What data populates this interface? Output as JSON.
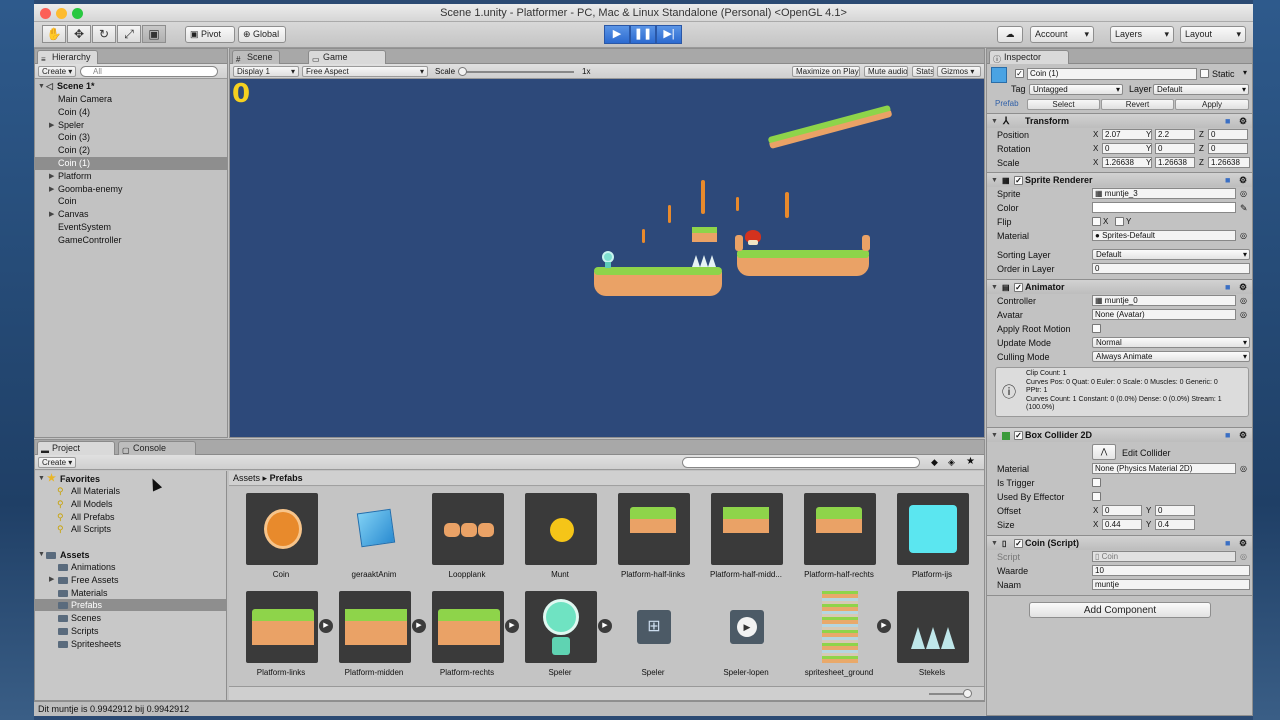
{
  "window": {
    "title": "Scene 1.unity - Platformer - PC, Mac & Linux Standalone (Personal) <OpenGL 4.1>"
  },
  "toolbar": {
    "pivot": "Pivot",
    "global": "Global",
    "account": "Account",
    "layers": "Layers",
    "layout": "Layout"
  },
  "hierarchy": {
    "tab": "Hierarchy",
    "create": "Create",
    "search_placeholder": "All",
    "scene": "Scene 1*",
    "items": [
      "Main Camera",
      "Coin (4)",
      "Speler",
      "Coin (3)",
      "Coin (2)",
      "Coin (1)",
      "Platform",
      "Goomba-enemy",
      "Coin",
      "Canvas",
      "EventSystem",
      "GameController"
    ],
    "selected": "Coin (1)"
  },
  "scene_tabs": {
    "scene": "Scene",
    "game": "Game"
  },
  "game_bar": {
    "display": "Display 1",
    "aspect": "Free Aspect",
    "scale_label": "Scale",
    "scale_value": "1x",
    "maximize": "Maximize on Play",
    "mute": "Mute audio",
    "stats": "Stats",
    "gizmos": "Gizmos"
  },
  "game": {
    "score": "0"
  },
  "inspector": {
    "tab": "Inspector",
    "name": "Coin (1)",
    "static": "Static",
    "tag_label": "Tag",
    "tag": "Untagged",
    "layer_label": "Layer",
    "layer": "Default",
    "prefab": "Prefab",
    "select": "Select",
    "revert": "Revert",
    "apply": "Apply",
    "transform": {
      "title": "Transform",
      "position_label": "Position",
      "position": [
        "2.07",
        "2.2",
        "0"
      ],
      "rotation_label": "Rotation",
      "rotation": [
        "0",
        "0",
        "0"
      ],
      "scale_label": "Scale",
      "scale": [
        "1.26638",
        "1.26638",
        "1.26638"
      ],
      "x": "X",
      "y": "Y",
      "z": "Z"
    },
    "sprite_renderer": {
      "title": "Sprite Renderer",
      "sprite_label": "Sprite",
      "sprite": "muntje_3",
      "color_label": "Color",
      "flip_label": "Flip",
      "flip_x": "X",
      "flip_y": "Y",
      "material_label": "Material",
      "material": "Sprites-Default",
      "sorting_label": "Sorting Layer",
      "sorting": "Default",
      "order_label": "Order in Layer",
      "order": "0"
    },
    "animator": {
      "title": "Animator",
      "controller_label": "Controller",
      "controller": "muntje_0",
      "avatar_label": "Avatar",
      "avatar": "None (Avatar)",
      "root_motion_label": "Apply Root Motion",
      "update_label": "Update Mode",
      "update": "Normal",
      "culling_label": "Culling Mode",
      "culling": "Always Animate",
      "info": [
        "Clip Count: 1",
        "Curves Pos: 0 Quat: 0 Euler: 0 Scale: 0 Muscles: 0 Generic: 0",
        "PPtr: 1",
        "Curves Count: 1 Constant: 0 (0.0%) Dense: 0 (0.0%) Stream: 1",
        "(100.0%)"
      ]
    },
    "box_collider": {
      "title": "Box Collider 2D",
      "edit": "Edit Collider",
      "material_label": "Material",
      "material": "None (Physics Material 2D)",
      "trigger_label": "Is Trigger",
      "effector_label": "Used By Effector",
      "offset_label": "Offset",
      "offset": [
        "0",
        "0"
      ],
      "size_label": "Size",
      "size": [
        "0.44",
        "0.4"
      ]
    },
    "coin_script": {
      "title": "Coin (Script)",
      "script_label": "Script",
      "script": "Coin",
      "waarde_label": "Waarde",
      "waarde": "10",
      "naam_label": "Naam",
      "naam": "muntje"
    },
    "add_component": "Add Component"
  },
  "project": {
    "tab": "Project",
    "console_tab": "Console",
    "create": "Create",
    "favorites": "Favorites",
    "favorite_items": [
      "All Materials",
      "All Models",
      "All Prefabs",
      "All Scripts"
    ],
    "assets": "Assets",
    "asset_folders": [
      "Animations",
      "Free Assets",
      "Materials",
      "Prefabs",
      "Scenes",
      "Scripts",
      "Spritesheets"
    ],
    "selected_folder": "Prefabs",
    "breadcrumb": [
      "Assets",
      "Prefabs"
    ],
    "grid_row1": [
      "Coin",
      "geraaktAnim",
      "Loopplank",
      "Munt",
      "Platform-half-links",
      "Platform-half-midd...",
      "Platform-half-rechts",
      "Platform-ijs"
    ],
    "grid_row2": [
      "Platform-links",
      "Platform-midden",
      "Platform-rechts",
      "Speler",
      "Speler",
      "Speler-lopen",
      "spritesheet_ground",
      "Stekels"
    ]
  },
  "status": {
    "text": "Dit muntje is 0.9942912 bij 0.9942912"
  },
  "colors": {
    "game_bg": "#2d497a",
    "grass": "#8ed44a",
    "dirt": "#eaa266",
    "coin_orange": "#e88a2c",
    "play_blue": "#2c6ad0",
    "score_yellow": "#f5d020"
  }
}
